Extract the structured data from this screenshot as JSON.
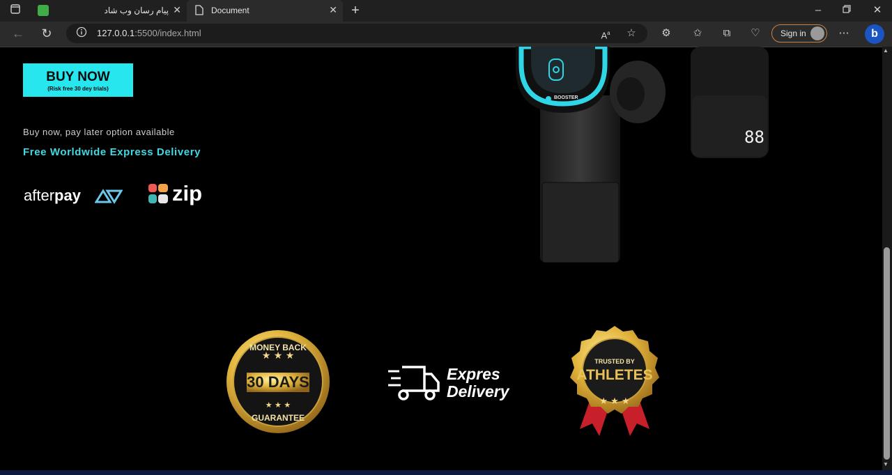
{
  "browser": {
    "tabs": [
      {
        "title": "پیام رسان وب شاد",
        "active": false
      },
      {
        "title": "Document",
        "active": true
      }
    ],
    "url_host": "127.0.0.1",
    "url_path": ":5500/index.html",
    "signin_label": "Sign in",
    "icons": [
      "tab-actions-icon",
      "new-tab-icon",
      "back-icon",
      "refresh-icon",
      "info-icon",
      "read-aloud-icon",
      "favorite-star-icon",
      "extensions-icon",
      "favorites-icon",
      "collections-icon",
      "health-icon",
      "more-icon",
      "bing-icon",
      "minimize-icon",
      "restore-icon",
      "close-window-icon"
    ]
  },
  "page": {
    "buy_button": {
      "label": "BUY NOW",
      "sublabel": "(Risk free 30 dey trials)"
    },
    "pay_later_text": "Buy now, pay later option available",
    "delivery_text": "Free Worldwide Express Delivery",
    "afterpay_logo": {
      "light": "after",
      "bold": "pay"
    },
    "zip_logo": "zip",
    "product": {
      "display_value": "88",
      "brand": "BOOSTER"
    },
    "badges": {
      "money_back": {
        "top": "MONEY BACK",
        "main": "30 DAYS",
        "bottom": "GUARANTEE"
      },
      "delivery": {
        "line1": "Expres",
        "line2": "Delivery"
      },
      "athletes": {
        "top": "TRUSTED BY",
        "main": "ATHLETES"
      }
    },
    "colors": {
      "accent_cyan": "#27e6ee",
      "delivery_text": "#3fd9e3",
      "gold": "#d9a93a",
      "ribbon_red": "#c8202a"
    }
  }
}
